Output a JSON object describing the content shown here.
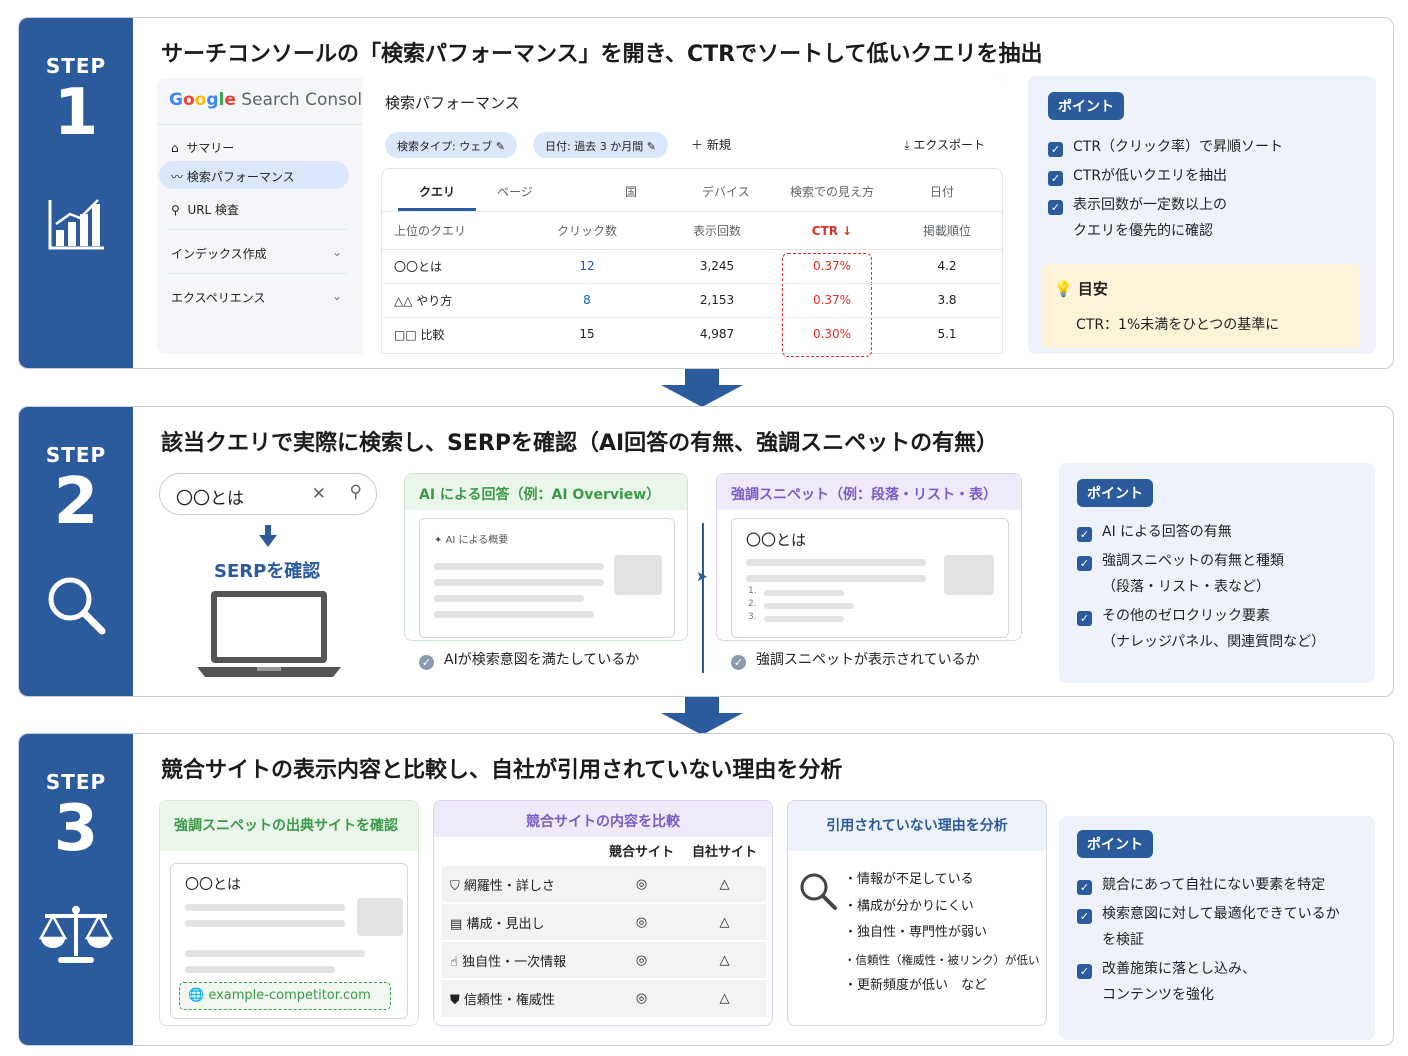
{
  "step1": {
    "step_label": "STEP",
    "step_num": "1",
    "title": "サーチコンソールの「検索パフォーマンス」を開き、CTRでソートして低いクエリを抽出",
    "gsc": {
      "logo": "Google",
      "logo_suffix": "Search Console",
      "nav": [
        "サマリー",
        "検索パフォーマンス",
        "URL 検査",
        "インデックス作成",
        "エクスペリエンス"
      ],
      "page_title": "検索パフォーマンス",
      "filter_type": "検索タイプ: ウェブ",
      "filter_date": "日付: 過去 3 か月間",
      "new_label": "新規",
      "export_label": "エクスポート",
      "tabs": [
        "クエリ",
        "ページ",
        "国",
        "デバイス",
        "検索での見え方",
        "日付"
      ],
      "columns": [
        "上位のクエリ",
        "クリック数",
        "表示回数",
        "CTR ↓",
        "掲載順位"
      ],
      "rows": [
        [
          "〇〇とは",
          "12",
          "3,245",
          "0.37%",
          "4.2"
        ],
        [
          "△△ やり方",
          "8",
          "2,153",
          "0.37%",
          "3.8"
        ],
        [
          "□□ 比較",
          "15",
          "4,987",
          "0.30%",
          "5.1"
        ]
      ]
    },
    "point": {
      "badge": "ポイント",
      "items": [
        "CTR（クリック率）で昇順ソート",
        "CTRが低いクエリを抽出",
        "表示回数が一定数以上の",
        "クエリを優先的に確認"
      ],
      "tip_title": "目安",
      "tip_text": "CTR：1%未満をひとつの基準に"
    }
  },
  "step2": {
    "step_label": "STEP",
    "step_num": "2",
    "title": "該当クエリで実際に検索し、SERPを確認（AI回答の有無、強調スニペットの有無）",
    "search_value": "〇〇とは",
    "serp_label": "SERPを確認",
    "ai_header": "AI による回答（例：AI Overview）",
    "ai_card_label": "AI による概要",
    "ai_check": "AIが検索意図を満たしているか",
    "snippet_header": "強調スニペット（例：段落・リスト・表）",
    "snippet_card_title": "〇〇とは",
    "snippet_list_nums": [
      "1.",
      "2.",
      "3."
    ],
    "snippet_check": "強調スニペットが表示されているか",
    "point": {
      "badge": "ポイント",
      "items": [
        "AI による回答の有無",
        "強調スニペットの有無と種類",
        "（段落・リスト・表など）",
        "その他のゼロクリック要素",
        "（ナレッジパネル、関連質問など）"
      ]
    }
  },
  "step3": {
    "step_label": "STEP",
    "step_num": "3",
    "title": "競合サイトの表示内容と比較し、自社が引用されていない理由を分析",
    "source_header": "強調スニペットの出典サイトを確認",
    "source_card_title": "〇〇とは",
    "source_url": "example-competitor.com",
    "compare_header": "競合サイトの内容を比較",
    "compare_cols": [
      "競合サイト",
      "自社サイト"
    ],
    "compare_rows": [
      {
        "label": "網羅性・詳しさ",
        "comp": "◎",
        "own": "△",
        "icon": "shield-icon"
      },
      {
        "label": "構成・見出し",
        "comp": "◎",
        "own": "△",
        "icon": "document-icon"
      },
      {
        "label": "独自性・一次情報",
        "comp": "◎",
        "own": "△",
        "icon": "thumbs-up-icon"
      },
      {
        "label": "信頼性・権威性",
        "comp": "◎",
        "own": "△",
        "icon": "badge-icon"
      }
    ],
    "reason_header": "引用されていない理由を分析",
    "reasons": [
      "・情報が不足している",
      "・構成が分かりにくい",
      "・独自性・専門性が弱い",
      "・信頼性（権威性・被リンク）が低い",
      "・更新頻度が低い　など"
    ],
    "point": {
      "badge": "ポイント",
      "items": [
        "競合にあって自社にない要素を特定",
        "検索意図に対して最適化できているか",
        "を検証",
        "改善施策に落とし込み、",
        "コンテンツを強化"
      ]
    }
  },
  "colors": {
    "brand": "#2c5b9d",
    "ctr_red": "#d93025",
    "green": "#3b9a4a",
    "purple": "#7b5cc7"
  }
}
